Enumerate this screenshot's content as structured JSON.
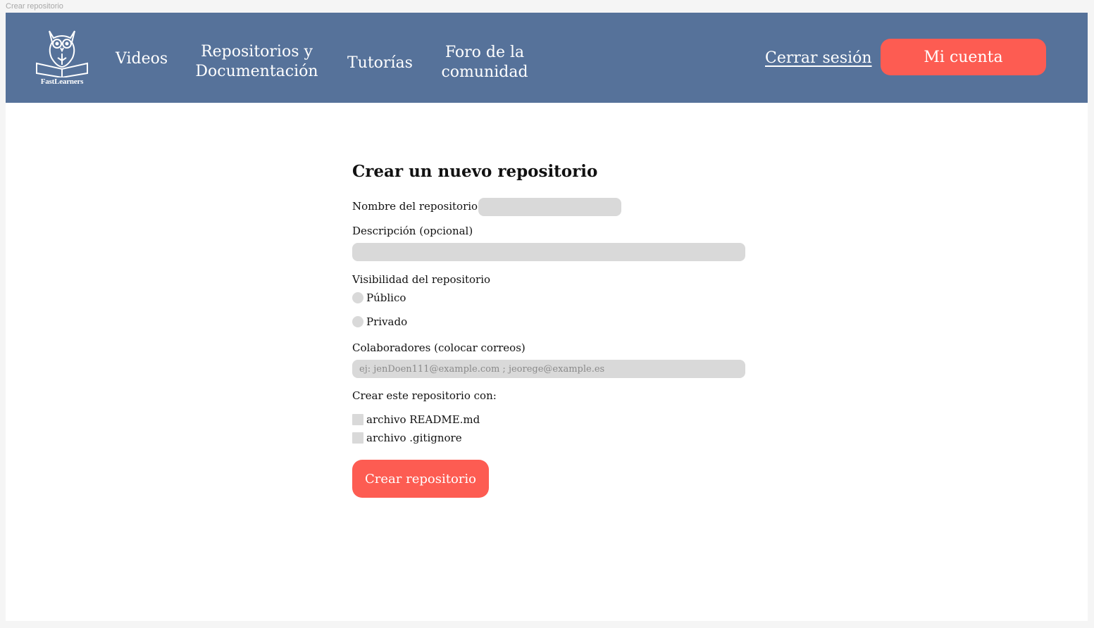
{
  "frame": {
    "label": "Crear repositorio"
  },
  "brand": {
    "name": "FastLearners"
  },
  "nav": {
    "videos": "Videos",
    "repos_line1": "Repositorios y",
    "repos_line2": "Documentación",
    "tutorias": "Tutorías",
    "foro_line1": "Foro de la",
    "foro_line2": "comunidad"
  },
  "header": {
    "logout": "Cerrar sesión",
    "account": "Mi cuenta"
  },
  "form": {
    "title": "Crear un nuevo repositorio",
    "name_label": "Nombre del repositorio",
    "name_value": "",
    "description_label": "Descripción (opcional)",
    "description_value": "",
    "visibility_label": "Visibilidad del repositorio",
    "visibility_options": [
      "Público",
      "Privado"
    ],
    "collaborators_label": "Colaboradores (colocar correos)",
    "collaborators_placeholder": "ej: jenDoen111@example.com ; jeorege@example.es",
    "create_with_label": "Crear este repositorio con:",
    "create_with_options": [
      "archivo README.md",
      "archivo .gitignore"
    ],
    "submit": "Crear repositorio"
  },
  "colors": {
    "navbar": "#56729a",
    "accent": "#fd5c52",
    "field": "#d9d9d9"
  },
  "icons": {
    "logo": "owl-book-icon"
  }
}
